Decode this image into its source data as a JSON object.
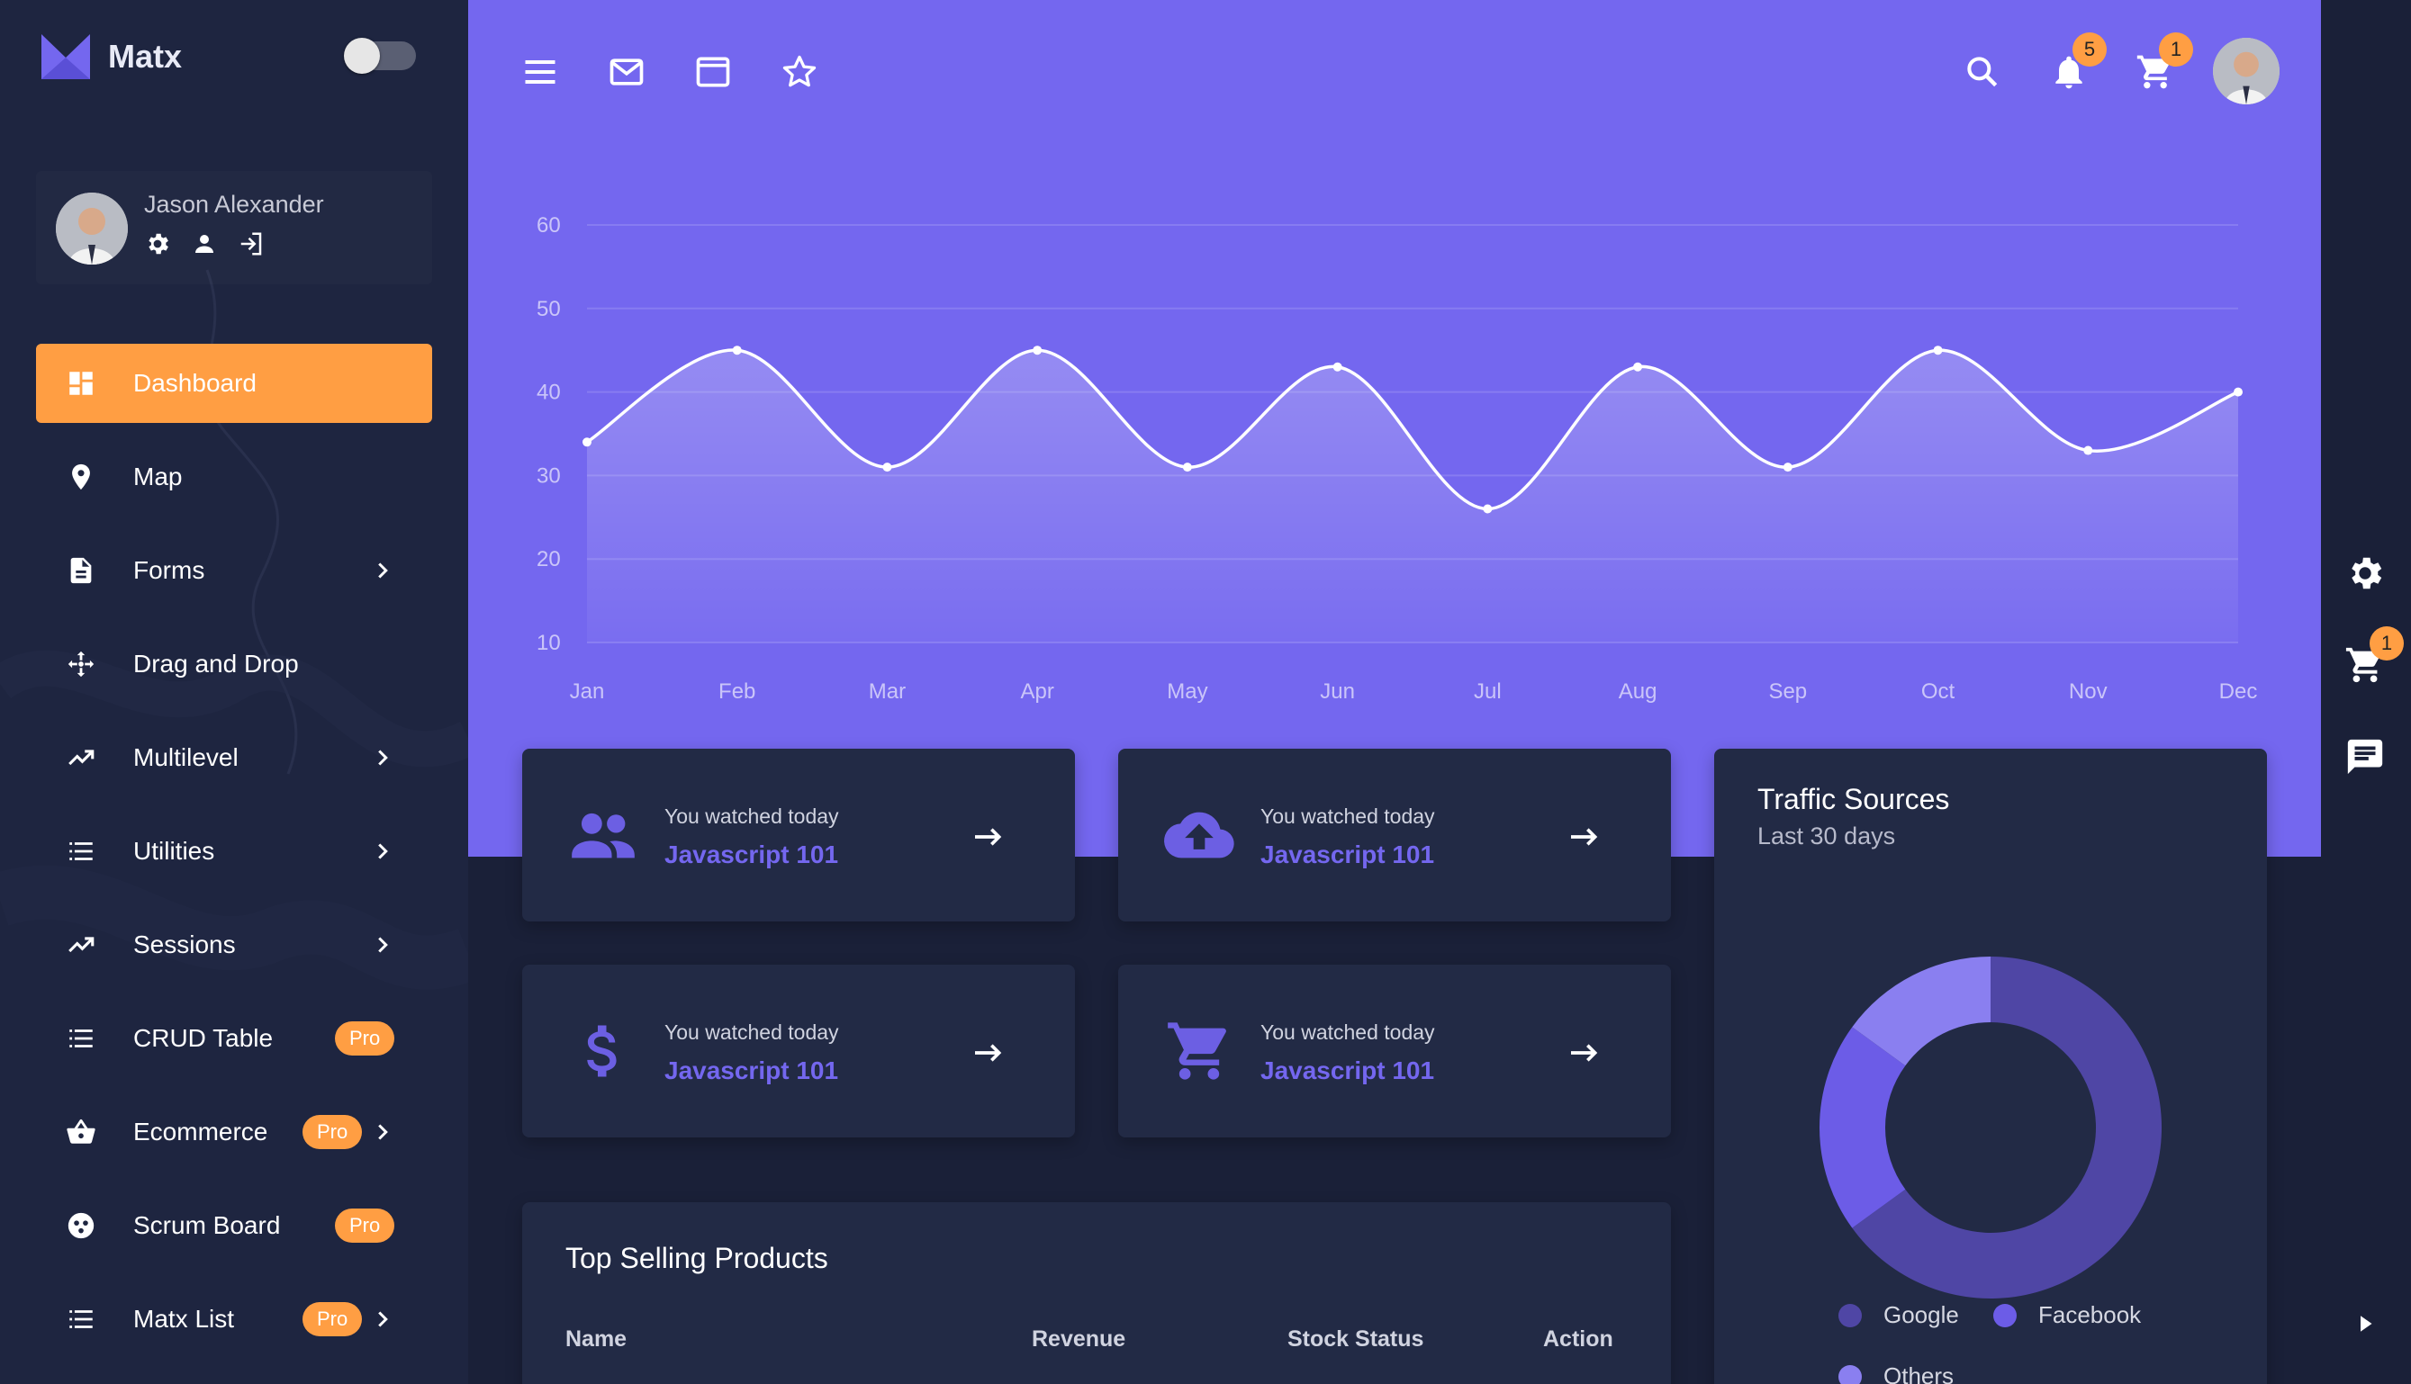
{
  "brand": {
    "name": "Matx"
  },
  "user": {
    "name": "Jason Alexander"
  },
  "nav": [
    {
      "label": "Dashboard",
      "icon": "dashboard-icon",
      "active": true
    },
    {
      "label": "Map",
      "icon": "map-pin-icon"
    },
    {
      "label": "Forms",
      "icon": "document-icon",
      "chevron": true
    },
    {
      "label": "Drag and Drop",
      "icon": "move-arrows-icon"
    },
    {
      "label": "Multilevel",
      "icon": "trending-up-icon",
      "chevron": true
    },
    {
      "label": "Utilities",
      "icon": "list-icon",
      "chevron": true
    },
    {
      "label": "Sessions",
      "icon": "trending-up-icon",
      "chevron": true
    },
    {
      "label": "CRUD Table",
      "icon": "list-icon",
      "badge": "Pro"
    },
    {
      "label": "Ecommerce",
      "icon": "basket-icon",
      "badge": "Pro",
      "chevron": true
    },
    {
      "label": "Scrum Board",
      "icon": "face-icon",
      "badge": "Pro"
    },
    {
      "label": "Matx List",
      "icon": "list-icon",
      "badge": "Pro",
      "chevron": true
    }
  ],
  "topbar": {
    "notifications_count": "5",
    "cart_count": "1"
  },
  "rail": {
    "cart_count": "1"
  },
  "chart_data": {
    "type": "area",
    "categories": [
      "Jan",
      "Feb",
      "Mar",
      "Apr",
      "May",
      "Jun",
      "Jul",
      "Aug",
      "Sep",
      "Oct",
      "Nov",
      "Dec"
    ],
    "series": [
      {
        "values": [
          34,
          45,
          31,
          45,
          31,
          43,
          26,
          43,
          31,
          45,
          33,
          40
        ]
      }
    ],
    "yticks": [
      60,
      50,
      40,
      30,
      20,
      10
    ],
    "ylim": [
      10,
      60
    ],
    "grid": true
  },
  "stat_cards": [
    {
      "icon": "group-icon",
      "caption": "You watched today",
      "value": "Javascript 101"
    },
    {
      "icon": "cloud-upload-icon",
      "caption": "You watched today",
      "value": "Javascript 101"
    },
    {
      "icon": "dollar-icon",
      "caption": "You watched today",
      "value": "Javascript 101"
    },
    {
      "icon": "cart-icon",
      "caption": "You watched today",
      "value": "Javascript 101"
    }
  ],
  "traffic": {
    "title": "Traffic Sources",
    "subtitle": "Last 30 days",
    "chart_data": {
      "type": "pie",
      "labels": [
        "Google",
        "Facebook",
        "Others"
      ],
      "values": [
        65,
        20,
        15
      ],
      "colors": [
        "#4f46a5",
        "#6c5ce7",
        "#8a7ff0"
      ]
    }
  },
  "top_selling": {
    "title": "Top Selling Products",
    "columns": [
      "Name",
      "Revenue",
      "Stock Status",
      "Action"
    ]
  },
  "colors": {
    "accent": "#ff9e43",
    "primary": "#7467ef",
    "surface": "#222a45",
    "background": "#1a2038"
  }
}
